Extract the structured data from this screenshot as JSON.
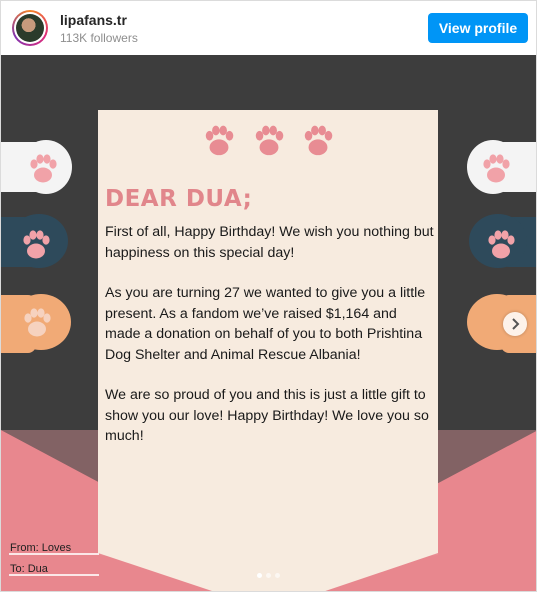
{
  "post_header": {
    "username": "lipafans.tr",
    "followers": "113K followers",
    "view_profile_label": "View profile"
  },
  "letter": {
    "greeting": "DEAR DUA;",
    "paragraphs": [
      "First of all, Happy Birthday! We wish you nothing but happiness on this special day!",
      "As you are turning 27 we wanted to give you a little present. As a fandom we’ve raised $1,164 and made a donation on behalf of you to both Prishtina Dog Shelter and Animal Rescue Albania!",
      "We are so proud of you and this is just a little gift to show you our love! Happy Birthday! We love you so much!"
    ]
  },
  "envelope": {
    "from_label": "From: Loves",
    "to_label": "To:  Dua"
  },
  "carousel": {
    "total_slides": 3,
    "active_slide": 1
  },
  "colors": {
    "background": "#3d3d3d",
    "card": "#f7ebdf",
    "envelope": "#e8878e",
    "accent_text": "#e1868b",
    "paw_pink": "#f1a2a8",
    "view_profile_button": "#0095f6"
  }
}
